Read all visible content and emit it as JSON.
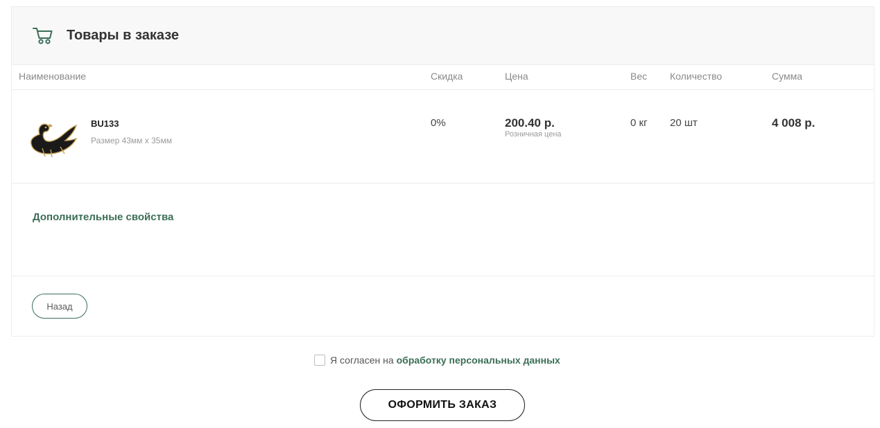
{
  "header": {
    "title": "Товары в заказе",
    "icon": "cart-icon"
  },
  "columns": {
    "name": "Наименование",
    "discount": "Скидка",
    "price": "Цена",
    "weight": "Вес",
    "quantity": "Количество",
    "sum": "Сумма"
  },
  "items": [
    {
      "image_icon": "swan-brooch-thumbnail",
      "sku": "BU133",
      "property": "Размер  43мм x 35мм",
      "discount": "0%",
      "price": "200.40 р.",
      "price_note": "Розничная цена",
      "weight": "0 кг",
      "quantity": "20 шт",
      "sum": "4 008 р."
    }
  ],
  "extra": {
    "title": "Дополнительные свойства"
  },
  "actions": {
    "back_label": "Назад",
    "order_label": "ОФОРМИТЬ ЗАКАЗ"
  },
  "consent": {
    "text": "Я согласен на",
    "link": "обработку персональных данных",
    "checked": false
  },
  "colors": {
    "accent": "#3b6e57",
    "border": "#ececec",
    "header_bg": "#f8f8f8"
  }
}
